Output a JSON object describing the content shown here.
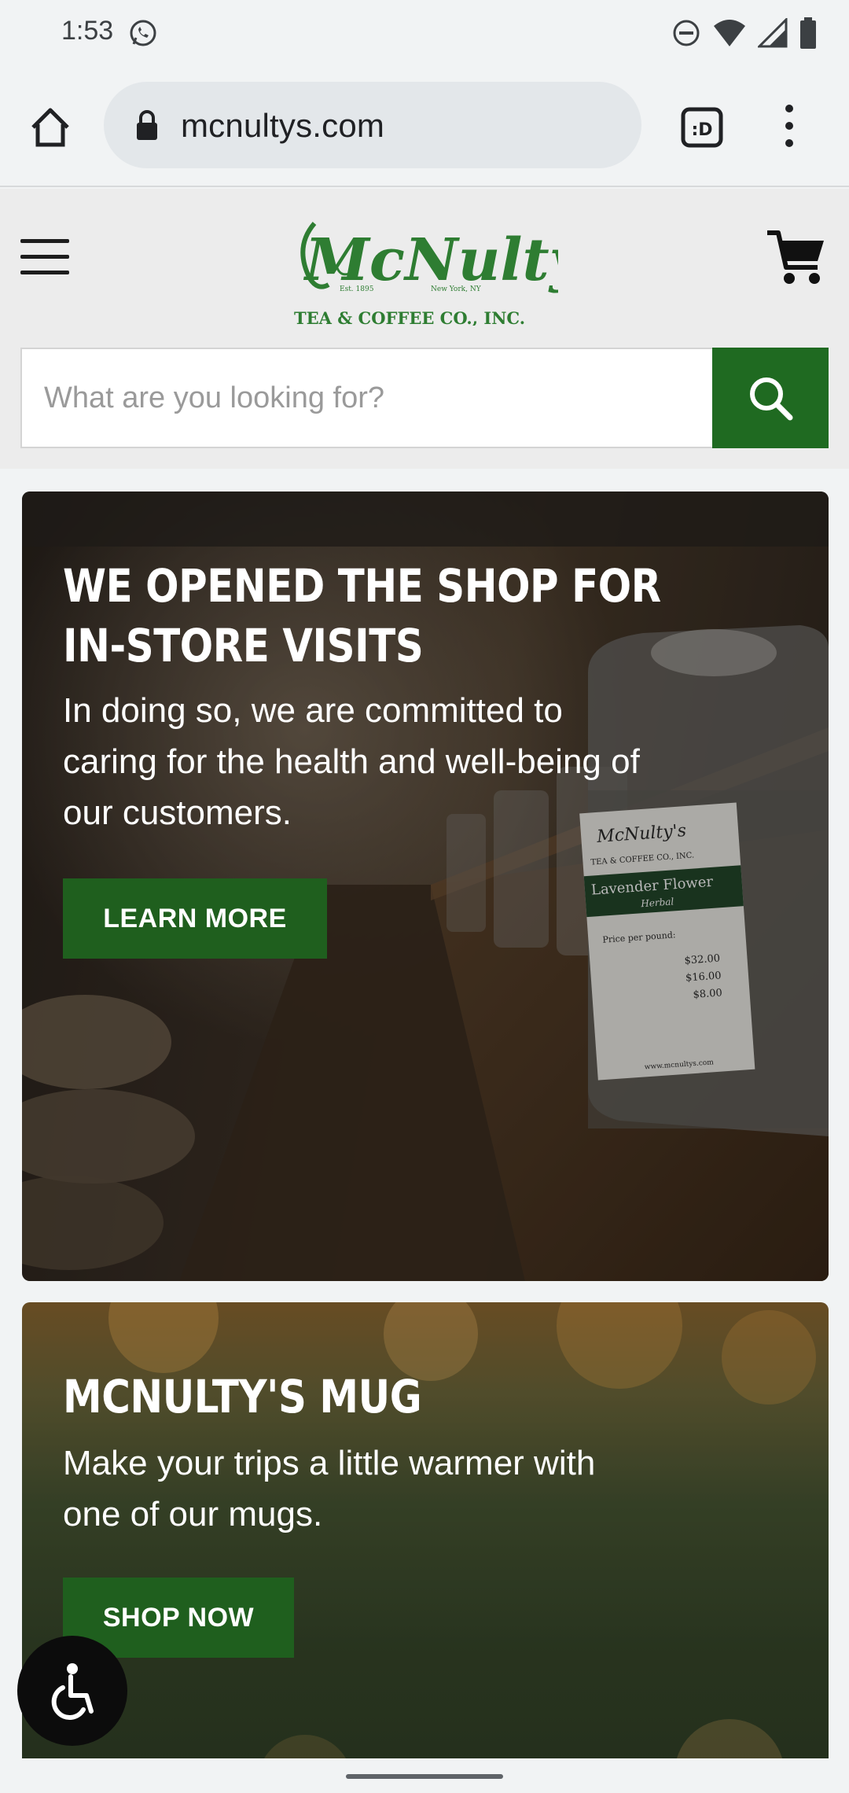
{
  "status_bar": {
    "time": "1:53"
  },
  "browser": {
    "url": "mcnultys.com"
  },
  "site": {
    "logo_name": "McNulty's",
    "logo_est": "Est. 1895",
    "logo_city": "New York, NY",
    "logo_tagline": "TEA & COFFEE CO., INC.",
    "search_placeholder": "What are you looking for?"
  },
  "banners": [
    {
      "title_line1": "WE OPENED THE SHOP FOR",
      "title_line2": "IN-STORE VISITS",
      "text": "In doing so, we are committed to caring for the health and well-being of our customers.",
      "button": "LEARN MORE",
      "jar_brand": "McNulty's",
      "jar_company": "TEA & COFFEE CO., INC.",
      "jar_product": "Lavender Flower",
      "jar_type": "Herbal",
      "jar_price_label": "Price per pound:",
      "jar_prices": [
        "$32.00",
        "$16.00",
        "$8.00"
      ],
      "jar_url": "www.mcnultys.com"
    },
    {
      "title": "MCNULTY'S MUG",
      "text": "Make your trips a little warmer with one of our mugs.",
      "button": "SHOP NOW"
    }
  ],
  "colors": {
    "brand_green": "#1f6a21",
    "button_green": "#1f5f1e",
    "logo_green": "#2e7d32"
  }
}
